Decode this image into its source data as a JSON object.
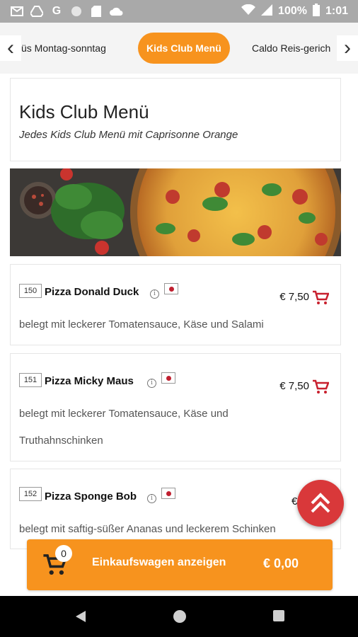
{
  "status_bar": {
    "icons": [
      "gmail-icon",
      "drive-icon",
      "google-icon",
      "circle-icon",
      "sd-card-icon",
      "cloud-icon"
    ],
    "battery": "100%",
    "time": "1:01"
  },
  "categories": {
    "items": [
      {
        "label": "üs Montag-sonntag"
      },
      {
        "label": "Kids Club Menü"
      },
      {
        "label": "Caldo Reis-gerich"
      }
    ],
    "prev_arrow": "‹",
    "next_arrow": "›"
  },
  "section": {
    "title": "Kids Club Menü",
    "subtitle": "Jedes Kids Club Menü mit Caprisonne Orange"
  },
  "items": [
    {
      "number": "150",
      "name": "Pizza Donald Duck",
      "price": "€ 7,50",
      "description_lines": [
        "belegt mit leckerer Tomatensauce, Käse und Salami"
      ]
    },
    {
      "number": "151",
      "name": "Pizza Micky Maus",
      "price": "€ 7,50",
      "description_lines": [
        "belegt mit leckerer Tomatensauce, Käse und",
        "Truthahnschinken"
      ]
    },
    {
      "number": "152",
      "name": "Pizza Sponge Bob",
      "price": "€ 7,",
      "description_lines": [
        "belegt mit saftig-süßer Ananas und leckerem Schinken"
      ]
    }
  ],
  "cart": {
    "count": "0",
    "label": "Einkaufswagen anzeigen",
    "total": "€ 0,00"
  },
  "info_glyph": "i",
  "colors": {
    "accent": "#f7931e",
    "fab": "#d9383a",
    "cart_icon": "#c8202e"
  }
}
